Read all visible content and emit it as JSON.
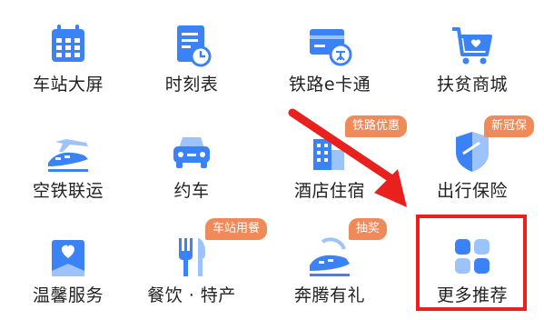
{
  "colors": {
    "icon_blue": "#3b82f6",
    "icon_light": "#9cc3fb",
    "badge": "#f08a5b",
    "arrow": "#e8201e",
    "highlight": "#e8201e"
  },
  "items": [
    {
      "label": "车站大屏",
      "icon": "calendar-icon"
    },
    {
      "label": "时刻表",
      "icon": "timetable-icon"
    },
    {
      "label": "铁路e卡通",
      "icon": "ecard-icon"
    },
    {
      "label": "扶贫商城",
      "icon": "shopping-cart-icon"
    },
    {
      "label": "空铁联运",
      "icon": "plane-train-icon"
    },
    {
      "label": "约车",
      "icon": "car-icon"
    },
    {
      "label": "酒店住宿",
      "icon": "hotel-icon",
      "badge": "铁路优惠"
    },
    {
      "label": "出行保险",
      "icon": "shield-icon",
      "badge": "新冠保"
    },
    {
      "label": "温馨服务",
      "icon": "heart-tag-icon"
    },
    {
      "label": "餐饮 · 特产",
      "icon": "fork-knife-icon",
      "badge": "车站用餐"
    },
    {
      "label": "奔腾有礼",
      "icon": "train-gift-icon",
      "badge": "抽奖"
    },
    {
      "label": "更多推荐",
      "icon": "more-grid-icon"
    }
  ]
}
